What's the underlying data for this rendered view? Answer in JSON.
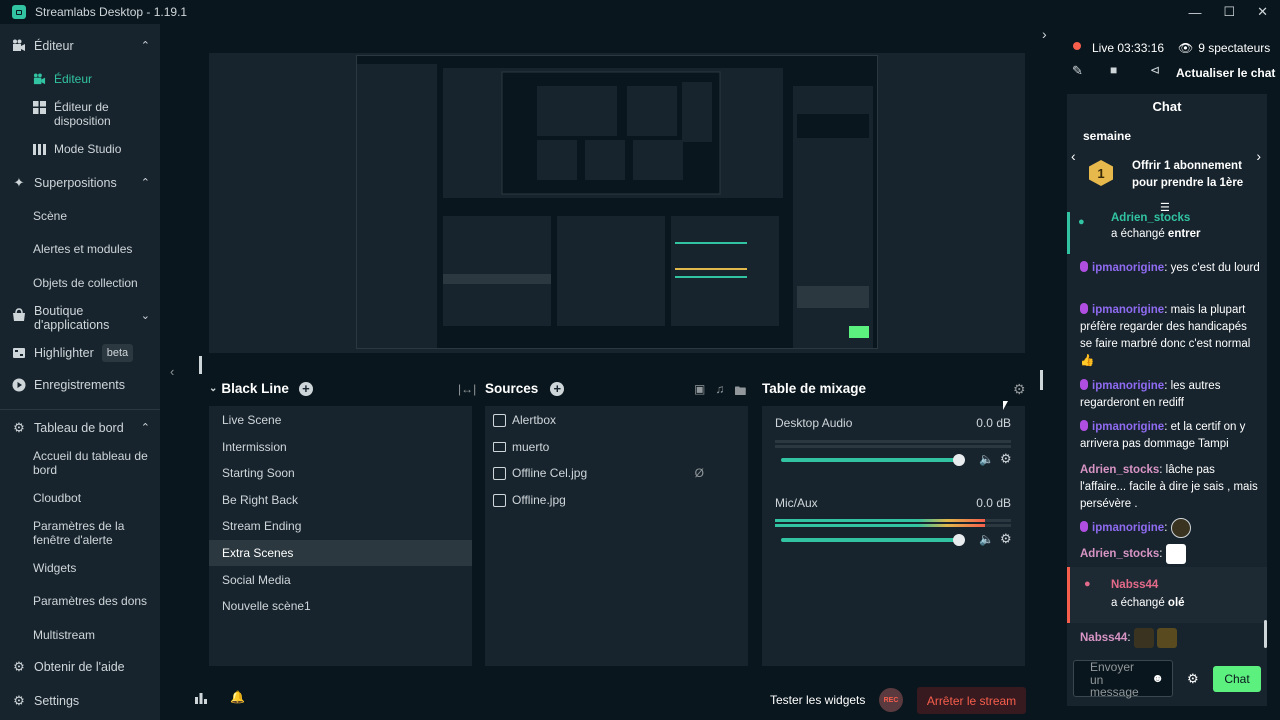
{
  "window": {
    "title": "Streamlabs Desktop - 1.19.1"
  },
  "sidebar": {
    "editor": {
      "label": "Éditeur",
      "items": [
        {
          "label": "Éditeur"
        },
        {
          "label": "Éditeur de disposition"
        },
        {
          "label": "Mode Studio"
        }
      ]
    },
    "overlays": {
      "label": "Superpositions",
      "items": [
        {
          "label": "Scène"
        },
        {
          "label": "Alertes et modules"
        },
        {
          "label": "Objets de collection"
        }
      ]
    },
    "appstore": {
      "label": "Boutique d'applications"
    },
    "highlighter": {
      "label": "Highlighter",
      "badge": "beta"
    },
    "recordings": {
      "label": "Enregistrements"
    },
    "dashboard": {
      "label": "Tableau de bord",
      "items": [
        {
          "label": "Accueil du tableau de bord"
        },
        {
          "label": "Cloudbot"
        },
        {
          "label": "Paramètres de la fenêtre d'alerte"
        },
        {
          "label": "Widgets"
        },
        {
          "label": "Paramètres des dons"
        },
        {
          "label": "Multistream"
        }
      ]
    },
    "help": {
      "label": "Obtenir de l'aide"
    },
    "settings": {
      "label": "Settings"
    }
  },
  "scenes": {
    "title": "Black Line",
    "items": [
      "Live Scene",
      "Intermission",
      "Starting Soon",
      "Be Right Back",
      "Stream Ending",
      "Extra Scenes",
      "Social Media",
      "Nouvelle scène1"
    ],
    "active_index": 5
  },
  "sources": {
    "title": "Sources",
    "items": [
      "Alertbox",
      "muerto",
      "Offline Cel.jpg",
      "Offline.jpg"
    ]
  },
  "mixer": {
    "title": "Table de mixage",
    "channels": [
      {
        "name": "Desktop Audio",
        "db": "0.0 dB",
        "meter": 0.0,
        "volume": 1.0
      },
      {
        "name": "Mic/Aux",
        "db": "0.0 dB",
        "meter": 0.89,
        "volume": 1.0
      }
    ]
  },
  "footer": {
    "test_widgets": "Tester les widgets",
    "rec": "REC",
    "stop_stream": "Arrêter le stream"
  },
  "live": {
    "status": "Live",
    "time": "03:33:16",
    "viewers": "9 spectateurs",
    "refresh": "Actualiser le chat"
  },
  "chat": {
    "title": "Chat",
    "cut_top": "semaine",
    "pinned": "Offrir 1 abonnement pour prendre la 1ère",
    "events": [
      {
        "user": "Adrien_stocks",
        "text": "a échangé",
        "item": "entrer"
      }
    ],
    "messages": [
      {
        "user": "ipmanorigine",
        "text": ": yes c'est du lourd"
      },
      {
        "user": "ipmanorigine",
        "text": ": mais la plupart préfère regarder des handicapés se faire marbré donc c'est normal"
      },
      {
        "user": "ipmanorigine",
        "text": ": les autres regarderont en rediff"
      },
      {
        "user": "ipmanorigine",
        "text": ": et la certif on y arrivera pas dommage Tampi"
      },
      {
        "user": "Adrien_stocks",
        "text": ": lâche pas l'affaire... facile à dire je sais , mais persévère ."
      },
      {
        "user": "ipmanorigine",
        "text": ":"
      },
      {
        "user": "Adrien_stocks",
        "text": ":"
      }
    ],
    "event2": {
      "user": "Nabss44",
      "text": "a échangé",
      "item": "olé"
    },
    "last": {
      "user": "Nabss44",
      "text": ":"
    },
    "input_placeholder": "Envoyer un message",
    "send": "Chat"
  },
  "colors": {
    "accent": "#31c3a2",
    "bg": "#09161d",
    "panel": "#17242d",
    "danger": "#f85e4c",
    "purple": "#8f6bf2"
  }
}
